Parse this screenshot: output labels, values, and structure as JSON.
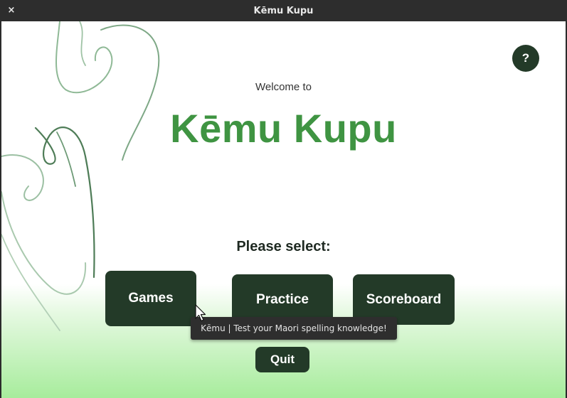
{
  "window": {
    "title": "Kēmu Kupu",
    "close_glyph": "×"
  },
  "main": {
    "welcome_text": "Welcome to",
    "app_title": "Kēmu Kupu",
    "prompt": "Please select:",
    "help_label": "?",
    "buttons": {
      "games": "Games",
      "practice": "Practice",
      "scoreboard": "Scoreboard",
      "quit": "Quit"
    },
    "tooltip": "Kēmu | Test your Maori spelling knowledge!"
  },
  "icons": {
    "close": "close-icon",
    "help": "question-mark-icon",
    "cursor": "mouse-pointer-icon",
    "decoration": "koru-pattern"
  },
  "colors": {
    "title_green": "#3f9442",
    "button_dark_green": "#233a28",
    "background_gradient_bottom": "#a7ec9c",
    "titlebar": "#2d2d2d"
  }
}
